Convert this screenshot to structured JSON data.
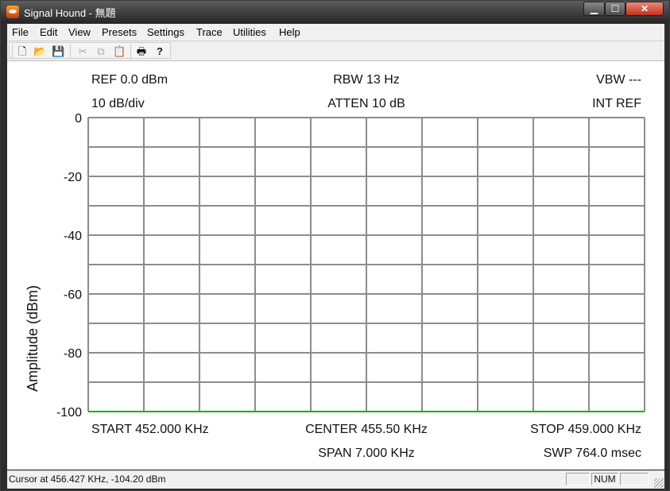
{
  "window": {
    "title": "Signal Hound - 無題"
  },
  "menu": [
    "File",
    "Edit",
    "View",
    "Presets",
    "Settings",
    "Trace",
    "Utilities",
    "Help"
  ],
  "toolbar": {
    "tools": [
      {
        "name": "new-icon",
        "glyph": "🗋",
        "enabled": true
      },
      {
        "name": "open-icon",
        "glyph": "📂",
        "enabled": true
      },
      {
        "name": "save-icon",
        "glyph": "💾",
        "enabled": true
      },
      {
        "name": "cut-icon",
        "glyph": "✂",
        "enabled": false
      },
      {
        "name": "copy-icon",
        "glyph": "⧉",
        "enabled": false
      },
      {
        "name": "paste-icon",
        "glyph": "📋",
        "enabled": false
      },
      {
        "name": "print-icon",
        "glyph": "🖶",
        "enabled": true
      },
      {
        "name": "help-icon",
        "glyph": "?",
        "enabled": true
      }
    ]
  },
  "display": {
    "ref": "REF 0.0 dBm",
    "scale": "10 dB/div",
    "rbw": "RBW 13 Hz",
    "atten": "ATTEN 10 dB",
    "vbw": "VBW ---",
    "int_ref": "INT REF",
    "start": "START 452.000 KHz",
    "center": "CENTER 455.50 KHz",
    "span": "SPAN 7.000 KHz",
    "stop": "STOP 459.000 KHz",
    "sweep": "SWP 764.0 msec",
    "y_axis_label": "Amplitude (dBm)"
  },
  "chart_data": {
    "type": "line",
    "ylabel": "Amplitude (dBm)",
    "ylim": [
      -100,
      0
    ],
    "y_ticks": [
      "0",
      "-20",
      "-40",
      "-60",
      "-80",
      "-100"
    ],
    "xlim": [
      452.0,
      459.0
    ],
    "grid": true,
    "divisions": {
      "x": 10,
      "y": 10
    },
    "series": [
      {
        "color": "#00b400",
        "x": [
          452.0,
          459.0
        ],
        "y": [
          -100,
          -100
        ]
      }
    ]
  },
  "status": {
    "cursor": "Cursor at 456.427 KHz, -104.20 dBm",
    "num": "NUM"
  },
  "colors": {
    "grid": "#8c8c8c",
    "trace": "#00b400"
  }
}
